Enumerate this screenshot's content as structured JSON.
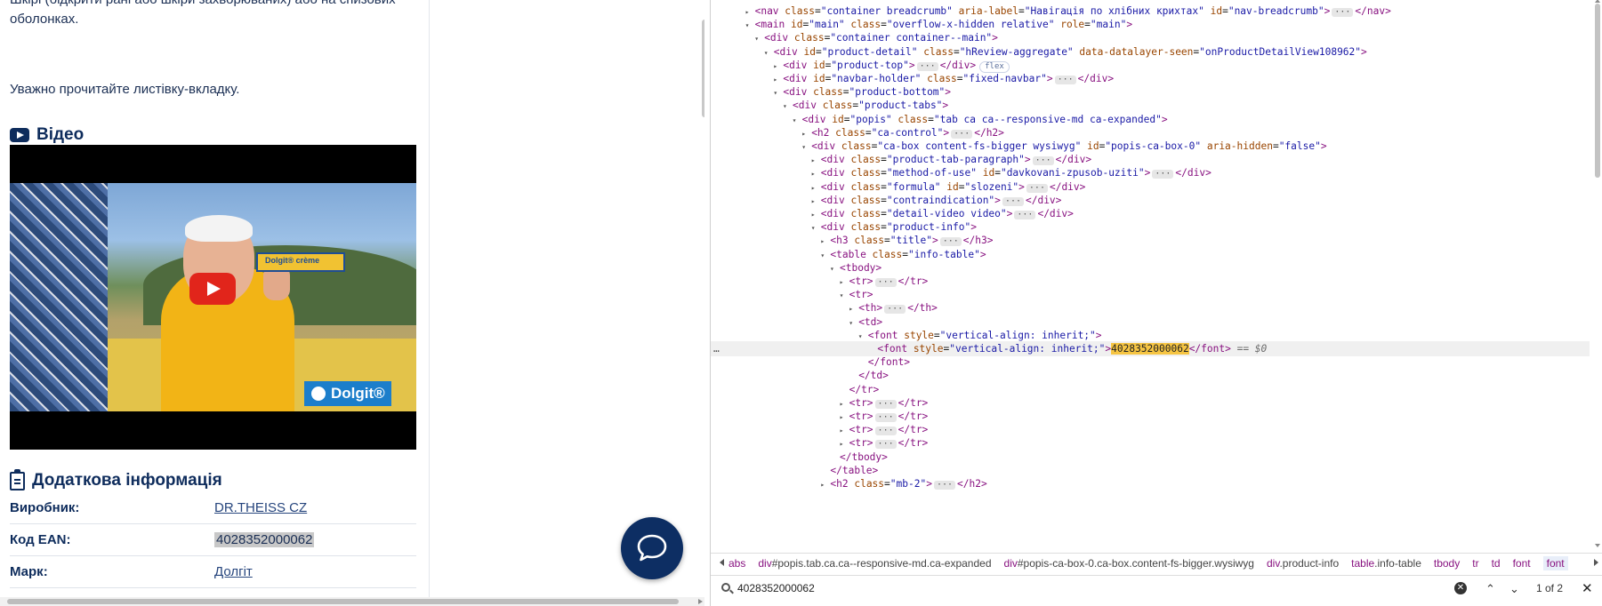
{
  "page": {
    "intro_line1": "Шкірі (бідкрити рані або шкіри захворюваних) або на спизових",
    "intro_line2": "оболонках.",
    "leaflet_note": "Уважно прочитайте листівку-вкладку.",
    "video_heading": "Відео",
    "video": {
      "product_box_label": "Dolgit® crème",
      "brand_text": "Dolgit®"
    },
    "info_heading": "Додаткова інформація",
    "info_rows": [
      {
        "label": "Виробник:",
        "value": "DR.THEISS CZ"
      },
      {
        "label": "Код EAN:",
        "value": "4028352000062"
      },
      {
        "label": "Марк:",
        "value": "Долгіт"
      }
    ]
  },
  "devtools": {
    "lines": [
      {
        "indent": 1,
        "tw": "▸",
        "parts": [
          [
            "tag",
            "<nav "
          ],
          [
            "an",
            "class"
          ],
          [
            "pl",
            "="
          ],
          [
            "av",
            "\"container breadcrumb\""
          ],
          [
            "pl",
            " "
          ],
          [
            "an",
            "aria-label"
          ],
          [
            "pl",
            "="
          ],
          [
            "av",
            "\"Навігація по хлібних крихтах\""
          ],
          [
            "pl",
            " "
          ],
          [
            "an",
            "id"
          ],
          [
            "pl",
            "="
          ],
          [
            "av",
            "\"nav-breadcrumb\""
          ],
          [
            "tag",
            ">"
          ],
          [
            "ell",
            "···"
          ],
          [
            "tag",
            "</nav>"
          ]
        ]
      },
      {
        "indent": 1,
        "tw": "▾",
        "parts": [
          [
            "tag",
            "<main "
          ],
          [
            "an",
            "id"
          ],
          [
            "pl",
            "="
          ],
          [
            "av",
            "\"main\""
          ],
          [
            "pl",
            " "
          ],
          [
            "an",
            "class"
          ],
          [
            "pl",
            "="
          ],
          [
            "av",
            "\"overflow-x-hidden relative\""
          ],
          [
            "pl",
            " "
          ],
          [
            "an",
            "role"
          ],
          [
            "pl",
            "="
          ],
          [
            "av",
            "\"main\""
          ],
          [
            "tag",
            ">"
          ]
        ]
      },
      {
        "indent": 2,
        "tw": "▾",
        "parts": [
          [
            "tag",
            "<div "
          ],
          [
            "an",
            "class"
          ],
          [
            "pl",
            "="
          ],
          [
            "av",
            "\"container container--main\""
          ],
          [
            "tag",
            ">"
          ]
        ]
      },
      {
        "indent": 3,
        "tw": "▾",
        "parts": [
          [
            "tag",
            "<div "
          ],
          [
            "an",
            "id"
          ],
          [
            "pl",
            "="
          ],
          [
            "av",
            "\"product-detail\""
          ],
          [
            "pl",
            " "
          ],
          [
            "an",
            "class"
          ],
          [
            "pl",
            "="
          ],
          [
            "av",
            "\"hReview-aggregate\""
          ],
          [
            "pl",
            " "
          ],
          [
            "an",
            "data-datalayer-seen"
          ],
          [
            "pl",
            "="
          ],
          [
            "av",
            "\"onProductDetailView108962\""
          ],
          [
            "tag",
            ">"
          ]
        ]
      },
      {
        "indent": 4,
        "tw": "▸",
        "parts": [
          [
            "tag",
            "<div "
          ],
          [
            "an",
            "id"
          ],
          [
            "pl",
            "="
          ],
          [
            "av",
            "\"product-top\""
          ],
          [
            "tag",
            ">"
          ],
          [
            "ell",
            "···"
          ],
          [
            "tag",
            "</div>"
          ],
          [
            "badge",
            "flex"
          ]
        ]
      },
      {
        "indent": 4,
        "tw": "▸",
        "parts": [
          [
            "tag",
            "<div "
          ],
          [
            "an",
            "id"
          ],
          [
            "pl",
            "="
          ],
          [
            "av",
            "\"navbar-holder\""
          ],
          [
            "pl",
            " "
          ],
          [
            "an",
            "class"
          ],
          [
            "pl",
            "="
          ],
          [
            "av",
            "\"fixed-navbar\""
          ],
          [
            "tag",
            ">"
          ],
          [
            "ell",
            "···"
          ],
          [
            "tag",
            "</div>"
          ]
        ]
      },
      {
        "indent": 4,
        "tw": "▾",
        "parts": [
          [
            "tag",
            "<div "
          ],
          [
            "an",
            "class"
          ],
          [
            "pl",
            "="
          ],
          [
            "av",
            "\"product-bottom\""
          ],
          [
            "tag",
            ">"
          ]
        ]
      },
      {
        "indent": 5,
        "tw": "▾",
        "parts": [
          [
            "tag",
            "<div "
          ],
          [
            "an",
            "class"
          ],
          [
            "pl",
            "="
          ],
          [
            "av",
            "\"product-tabs\""
          ],
          [
            "tag",
            ">"
          ]
        ]
      },
      {
        "indent": 6,
        "tw": "▾",
        "parts": [
          [
            "tag",
            "<div "
          ],
          [
            "an",
            "id"
          ],
          [
            "pl",
            "="
          ],
          [
            "av",
            "\"popis\""
          ],
          [
            "pl",
            " "
          ],
          [
            "an",
            "class"
          ],
          [
            "pl",
            "="
          ],
          [
            "av",
            "\"tab ca ca--responsive-md ca-expanded\""
          ],
          [
            "tag",
            ">"
          ]
        ]
      },
      {
        "indent": 7,
        "tw": "▸",
        "parts": [
          [
            "tag",
            "<h2 "
          ],
          [
            "an",
            "class"
          ],
          [
            "pl",
            "="
          ],
          [
            "av",
            "\"ca-control\""
          ],
          [
            "tag",
            ">"
          ],
          [
            "ell",
            "···"
          ],
          [
            "tag",
            "</h2>"
          ]
        ]
      },
      {
        "indent": 7,
        "tw": "▾",
        "parts": [
          [
            "tag",
            "<div "
          ],
          [
            "an",
            "class"
          ],
          [
            "pl",
            "="
          ],
          [
            "av",
            "\"ca-box content-fs-bigger wysiwyg\""
          ],
          [
            "pl",
            " "
          ],
          [
            "an",
            "id"
          ],
          [
            "pl",
            "="
          ],
          [
            "av",
            "\"popis-ca-box-0\""
          ],
          [
            "pl",
            " "
          ],
          [
            "an",
            "aria-hidden"
          ],
          [
            "pl",
            "="
          ],
          [
            "av",
            "\"false\""
          ],
          [
            "tag",
            ">"
          ]
        ]
      },
      {
        "indent": 8,
        "tw": "▸",
        "parts": [
          [
            "tag",
            "<div "
          ],
          [
            "an",
            "class"
          ],
          [
            "pl",
            "="
          ],
          [
            "av",
            "\"product-tab-paragraph\""
          ],
          [
            "tag",
            ">"
          ],
          [
            "ell",
            "···"
          ],
          [
            "tag",
            "</div>"
          ]
        ]
      },
      {
        "indent": 8,
        "tw": "▸",
        "parts": [
          [
            "tag",
            "<div "
          ],
          [
            "an",
            "class"
          ],
          [
            "pl",
            "="
          ],
          [
            "av",
            "\"method-of-use\""
          ],
          [
            "pl",
            " "
          ],
          [
            "an",
            "id"
          ],
          [
            "pl",
            "="
          ],
          [
            "av",
            "\"davkovani-zpusob-uziti\""
          ],
          [
            "tag",
            ">"
          ],
          [
            "ell",
            "···"
          ],
          [
            "tag",
            "</div>"
          ]
        ]
      },
      {
        "indent": 8,
        "tw": "▸",
        "parts": [
          [
            "tag",
            "<div "
          ],
          [
            "an",
            "class"
          ],
          [
            "pl",
            "="
          ],
          [
            "av",
            "\"formula\""
          ],
          [
            "pl",
            " "
          ],
          [
            "an",
            "id"
          ],
          [
            "pl",
            "="
          ],
          [
            "av",
            "\"slozeni\""
          ],
          [
            "tag",
            ">"
          ],
          [
            "ell",
            "···"
          ],
          [
            "tag",
            "</div>"
          ]
        ]
      },
      {
        "indent": 8,
        "tw": "▸",
        "parts": [
          [
            "tag",
            "<div "
          ],
          [
            "an",
            "class"
          ],
          [
            "pl",
            "="
          ],
          [
            "av",
            "\"contraindication\""
          ],
          [
            "tag",
            ">"
          ],
          [
            "ell",
            "···"
          ],
          [
            "tag",
            "</div>"
          ]
        ]
      },
      {
        "indent": 8,
        "tw": "▸",
        "parts": [
          [
            "tag",
            "<div "
          ],
          [
            "an",
            "class"
          ],
          [
            "pl",
            "="
          ],
          [
            "av",
            "\"detail-video video\""
          ],
          [
            "tag",
            ">"
          ],
          [
            "ell",
            "···"
          ],
          [
            "tag",
            "</div>"
          ]
        ]
      },
      {
        "indent": 8,
        "tw": "▾",
        "parts": [
          [
            "tag",
            "<div "
          ],
          [
            "an",
            "class"
          ],
          [
            "pl",
            "="
          ],
          [
            "av",
            "\"product-info\""
          ],
          [
            "tag",
            ">"
          ]
        ]
      },
      {
        "indent": 9,
        "tw": "▸",
        "parts": [
          [
            "tag",
            "<h3 "
          ],
          [
            "an",
            "class"
          ],
          [
            "pl",
            "="
          ],
          [
            "av",
            "\"title\""
          ],
          [
            "tag",
            ">"
          ],
          [
            "ell",
            "···"
          ],
          [
            "tag",
            "</h3>"
          ]
        ]
      },
      {
        "indent": 9,
        "tw": "▾",
        "parts": [
          [
            "tag",
            "<table "
          ],
          [
            "an",
            "class"
          ],
          [
            "pl",
            "="
          ],
          [
            "av",
            "\"info-table\""
          ],
          [
            "tag",
            ">"
          ]
        ]
      },
      {
        "indent": 10,
        "tw": "▾",
        "parts": [
          [
            "tag",
            "<tbody>"
          ]
        ]
      },
      {
        "indent": 11,
        "tw": "▸",
        "parts": [
          [
            "tag",
            "<tr>"
          ],
          [
            "ell",
            "···"
          ],
          [
            "tag",
            "</tr>"
          ]
        ]
      },
      {
        "indent": 11,
        "tw": "▾",
        "parts": [
          [
            "tag",
            "<tr>"
          ]
        ]
      },
      {
        "indent": 12,
        "tw": "▸",
        "parts": [
          [
            "tag",
            "<th>"
          ],
          [
            "ell",
            "···"
          ],
          [
            "tag",
            "</th>"
          ]
        ]
      },
      {
        "indent": 12,
        "tw": "▾",
        "parts": [
          [
            "tag",
            "<td>"
          ]
        ]
      },
      {
        "indent": 13,
        "tw": "▾",
        "parts": [
          [
            "tag",
            "<font "
          ],
          [
            "an",
            "style"
          ],
          [
            "pl",
            "="
          ],
          [
            "av",
            "\"vertical-align: inherit;\""
          ],
          [
            "tag",
            ">"
          ]
        ]
      },
      {
        "indent": 14,
        "tw": "",
        "sel": true,
        "parts": [
          [
            "tag",
            "<font "
          ],
          [
            "an",
            "style"
          ],
          [
            "pl",
            "="
          ],
          [
            "av",
            "\"vertical-align: inherit;\""
          ],
          [
            "tag",
            ">"
          ],
          [
            "hit",
            "4028352000062"
          ],
          [
            "tag",
            "</font>"
          ],
          [
            "dim",
            " == $0"
          ]
        ]
      },
      {
        "indent": 13,
        "tw": "",
        "parts": [
          [
            "tag",
            "</font>"
          ]
        ]
      },
      {
        "indent": 12,
        "tw": "",
        "parts": [
          [
            "tag",
            "</td>"
          ]
        ]
      },
      {
        "indent": 11,
        "tw": "",
        "parts": [
          [
            "tag",
            "</tr>"
          ]
        ]
      },
      {
        "indent": 11,
        "tw": "▸",
        "parts": [
          [
            "tag",
            "<tr>"
          ],
          [
            "ell",
            "···"
          ],
          [
            "tag",
            "</tr>"
          ]
        ]
      },
      {
        "indent": 11,
        "tw": "▸",
        "parts": [
          [
            "tag",
            "<tr>"
          ],
          [
            "ell",
            "···"
          ],
          [
            "tag",
            "</tr>"
          ]
        ]
      },
      {
        "indent": 11,
        "tw": "▸",
        "parts": [
          [
            "tag",
            "<tr>"
          ],
          [
            "ell",
            "···"
          ],
          [
            "tag",
            "</tr>"
          ]
        ]
      },
      {
        "indent": 11,
        "tw": "▸",
        "parts": [
          [
            "tag",
            "<tr>"
          ],
          [
            "ell",
            "···"
          ],
          [
            "tag",
            "</tr>"
          ]
        ]
      },
      {
        "indent": 10,
        "tw": "",
        "parts": [
          [
            "tag",
            "</tbody>"
          ]
        ]
      },
      {
        "indent": 9,
        "tw": "",
        "parts": [
          [
            "tag",
            "</table>"
          ]
        ]
      },
      {
        "indent": 9,
        "tw": "▸",
        "parts": [
          [
            "tag",
            "<h2 "
          ],
          [
            "an",
            "class"
          ],
          [
            "pl",
            "="
          ],
          [
            "av",
            "\"mb-2\""
          ],
          [
            "tag",
            ">"
          ],
          [
            "ell",
            "···"
          ],
          [
            "tag",
            "</h2>"
          ]
        ]
      }
    ],
    "breadcrumbs": [
      {
        "t": "abs",
        "c": ""
      },
      {
        "t": "div",
        "c": "#popis.tab.ca.ca--responsive-md.ca-expanded"
      },
      {
        "t": "div",
        "c": "#popis-ca-box-0.ca-box.content-fs-bigger.wysiwyg"
      },
      {
        "t": "div",
        "c": ".product-info"
      },
      {
        "t": "table",
        "c": ".info-table"
      },
      {
        "t": "tbody",
        "c": ""
      },
      {
        "t": "tr",
        "c": ""
      },
      {
        "t": "td",
        "c": ""
      },
      {
        "t": "font",
        "c": ""
      },
      {
        "t": "font",
        "c": "",
        "active": true
      }
    ],
    "find": {
      "query": "4028352000062",
      "clear": "✕",
      "prev": "⌃",
      "next": "⌄",
      "count": "1 of 2",
      "close": "✕"
    }
  }
}
